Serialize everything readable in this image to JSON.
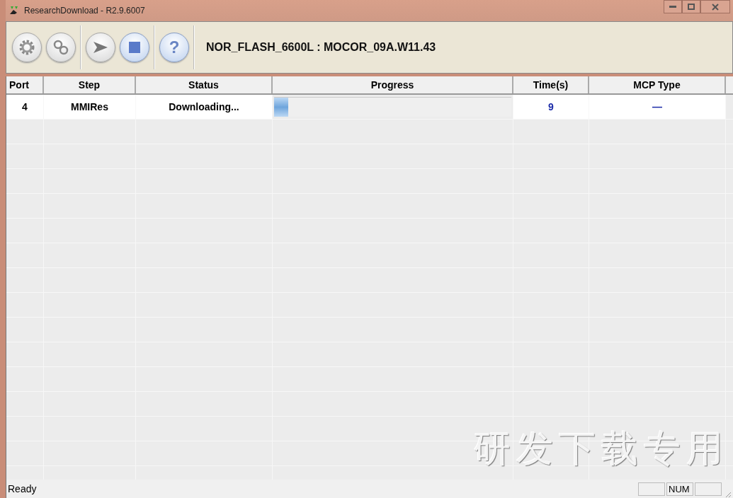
{
  "window": {
    "title": "ResearchDownload - R2.9.6007"
  },
  "toolbar": {
    "buttons": [
      {
        "kind": "gear"
      },
      {
        "kind": "gears"
      },
      {
        "kind": "play"
      },
      {
        "kind": "stop"
      },
      {
        "kind": "help",
        "label": "?"
      }
    ],
    "info": "NOR_FLASH_6600L : MOCOR_09A.W11.43"
  },
  "table": {
    "columns": [
      "Port",
      "Step",
      "Status",
      "Progress",
      "Time(s)",
      "MCP Type"
    ],
    "rows": [
      {
        "port": "4",
        "step": "MMIRes",
        "status": "Downloading...",
        "level": 0.06,
        "time": "9",
        "mcp_type": "—"
      }
    ]
  },
  "background_label": "研发下载专用",
  "status_bar": {
    "text": "Ready",
    "num_indicator": "NUM"
  }
}
